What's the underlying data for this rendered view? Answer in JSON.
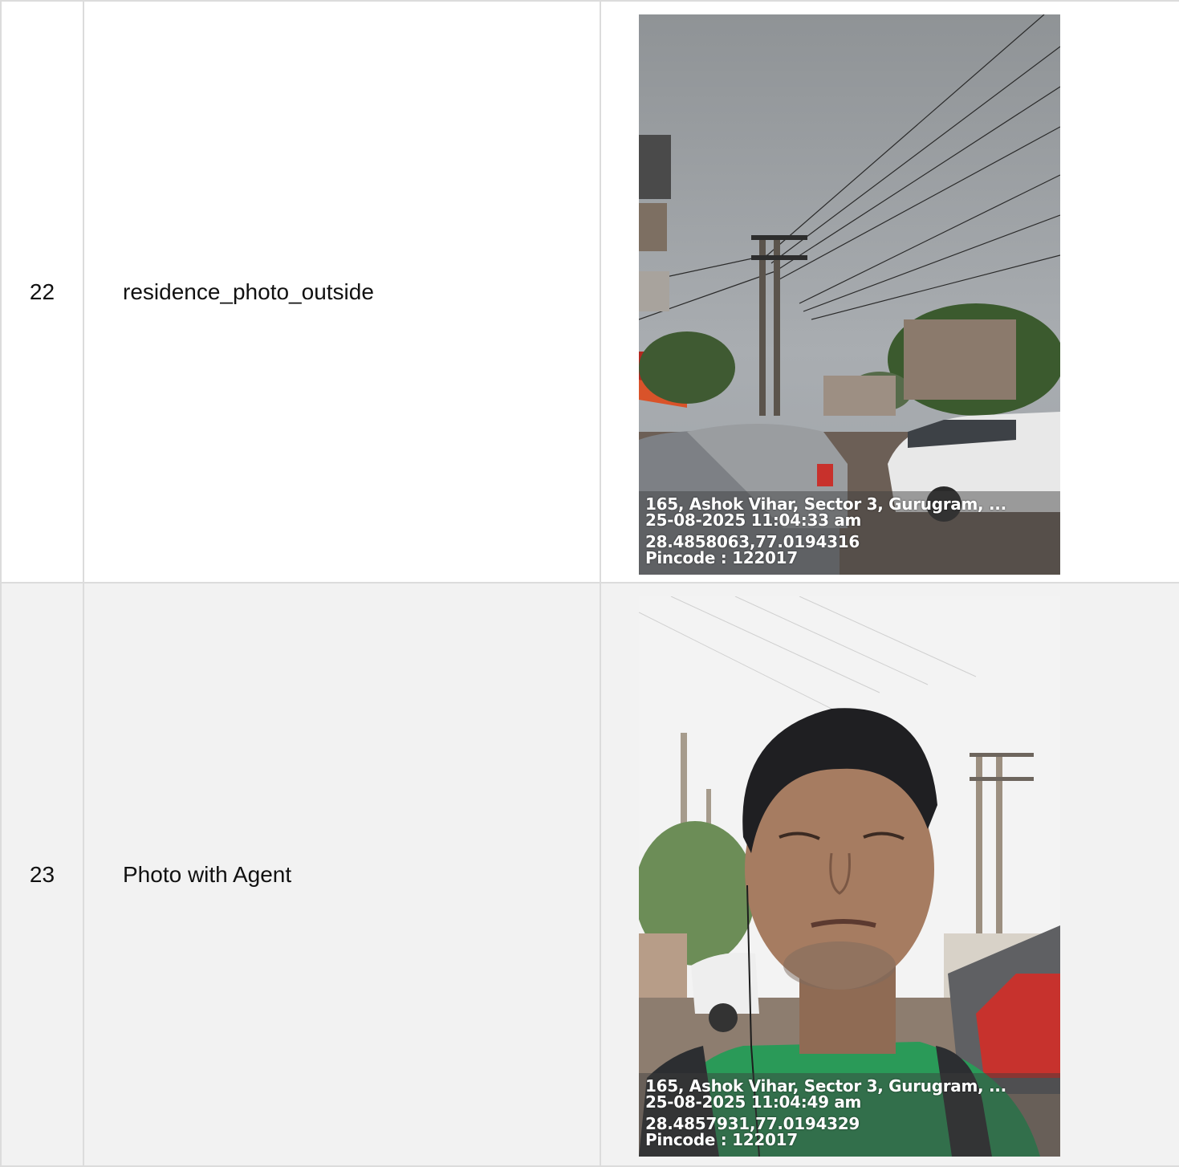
{
  "rows": [
    {
      "number": "22",
      "label": "residence_photo_outside",
      "photo": {
        "icon": "street-photo",
        "stamp": {
          "address": "165, Ashok Vihar, Sector 3, Gurugram, ...",
          "datetime": "25-08-2025 11:04:33 am",
          "coordinates": "28.4858063,77.0194316",
          "pincode": "Pincode : 122017"
        }
      }
    },
    {
      "number": "23",
      "label": "Photo with Agent",
      "photo": {
        "icon": "selfie-photo",
        "stamp": {
          "address": "165, Ashok Vihar, Sector 3, Gurugram, ...",
          "datetime": "25-08-2025 11:04:49 am",
          "coordinates": "28.4857931,77.0194329",
          "pincode": "Pincode : 122017"
        }
      }
    }
  ]
}
